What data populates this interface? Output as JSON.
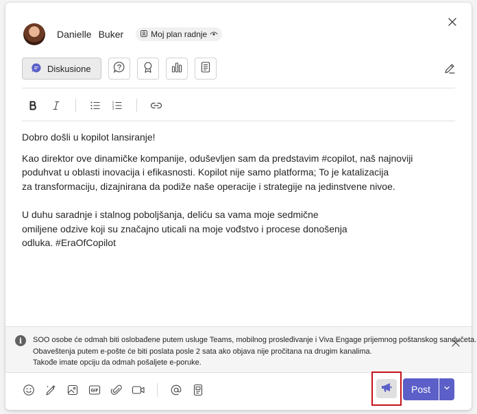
{
  "composer": {
    "author": {
      "first_name": "Danielle",
      "last_name": "Buker"
    },
    "audience": {
      "label": "Moj plan radnje"
    },
    "post_types": [
      {
        "label": "Diskusione",
        "icon": "discussion-icon",
        "selected": true
      },
      {
        "icon": "question-icon"
      },
      {
        "icon": "praise-icon"
      },
      {
        "icon": "poll-icon"
      },
      {
        "icon": "article-icon"
      }
    ],
    "formatting": [
      "bold-icon",
      "italic-icon",
      "bullet-list-icon",
      "numbered-list-icon",
      "link-icon"
    ],
    "body": {
      "greeting": "Dobro došli u kopilot lansiranje!",
      "paragraph1": "Kao direktor ove dinamičke kompanije, oduševljen sam da predstavim #copilot, naš najnoviji\npoduhvat u oblasti inovacija i efikasnosti. Kopilot nije samo platforma; To je katalizacija\nza transformaciju, dizajnirana da podiže naše operacije i strategije na jedinstvene nivoe.",
      "paragraph2": "U duhu saradnje i stalnog poboljšanja, deliću sa vama moje sedmične\nomiljene odzive koji su značajno uticali na moje vođstvo i procese donošenja\nodluka. #EraOfCopilot"
    },
    "notice": {
      "line1": "SOO osobe će odmah biti oslobađene putem usluge Teams, mobilnog prosleđivanje i Viva Engage prijemnog poštanskog sandučeta.",
      "line2": "Obaveštenja putem e-pošte će biti poslata posle 2 sata ako objava nije pročitana na drugim kanalima.",
      "line3": "Takođe imate opciju da odmah pošaljete e-poruke.",
      "info_glyph": "i"
    },
    "footer_icons": [
      "emoji-icon",
      "sparkle-pen-icon",
      "image-icon",
      "gif-icon",
      "attach-icon",
      "video-icon",
      "mention-icon",
      "form-icon"
    ],
    "post_button": {
      "label": "Post"
    },
    "colors": {
      "accent": "#5b5fc7",
      "highlight": "#c4121a"
    }
  }
}
